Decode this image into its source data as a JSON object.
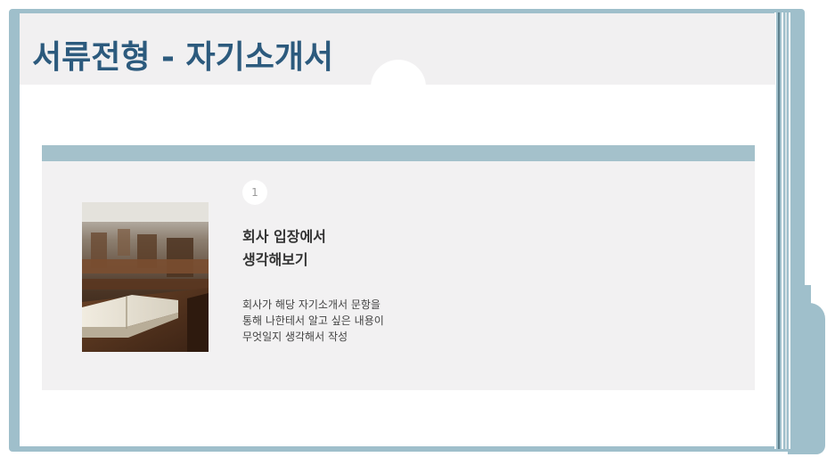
{
  "slide": {
    "title": "서류전형 - 자기소개서",
    "colors": {
      "accent": "#2c5a7d",
      "frame": "#9fbfcb",
      "card_bar": "#a4c1cb",
      "card_bg": "#f2f1f2"
    }
  },
  "step": {
    "number": "1",
    "heading_lines": [
      "회사 입장에서",
      "생각해보기"
    ],
    "description_lines": [
      "회사가 해당 자기소개서 문항을",
      "통해 나한테서 알고 싶은 내용이",
      "무엇일지 생각해서 작성"
    ]
  }
}
